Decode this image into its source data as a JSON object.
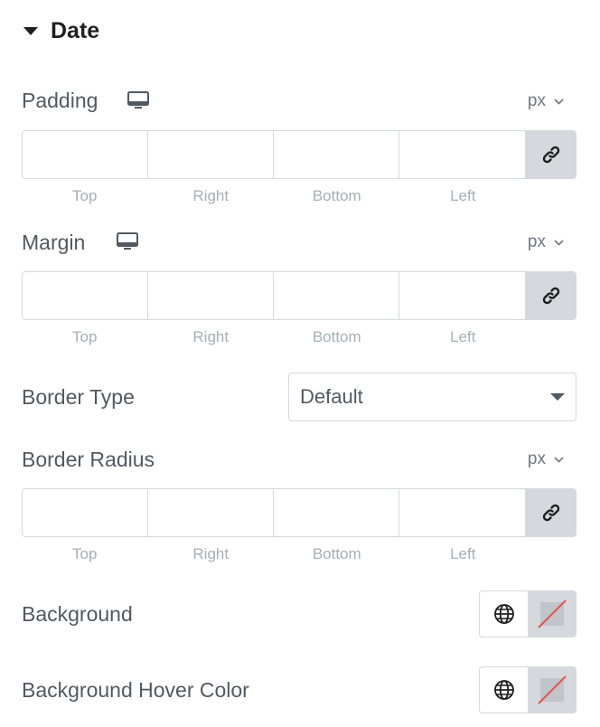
{
  "section": {
    "title": "Date"
  },
  "padding": {
    "label": "Padding",
    "unit": "px",
    "sides": [
      "Top",
      "Right",
      "Bottom",
      "Left"
    ],
    "values": [
      "",
      "",
      "",
      ""
    ]
  },
  "margin": {
    "label": "Margin",
    "unit": "px",
    "sides": [
      "Top",
      "Right",
      "Bottom",
      "Left"
    ],
    "values": [
      "",
      "",
      "",
      ""
    ]
  },
  "border_type": {
    "label": "Border Type",
    "value": "Default"
  },
  "border_radius": {
    "label": "Border Radius",
    "unit": "px",
    "sides": [
      "Top",
      "Right",
      "Bottom",
      "Left"
    ],
    "values": [
      "",
      "",
      "",
      ""
    ]
  },
  "background": {
    "label": "Background"
  },
  "background_hover": {
    "label": "Background Hover Color"
  },
  "icons": {
    "responsive": "desktop-icon",
    "link": "link-icon",
    "global": "globe-icon",
    "unit_dropdown": "chevron-down-icon",
    "collapse": "caret-down-icon"
  },
  "colors": {
    "label": "#515962",
    "muted": "#a4afb7",
    "border": "#d5d8dc",
    "swatch_empty": "#bfc5ca",
    "clear_line": "#e5554f"
  }
}
